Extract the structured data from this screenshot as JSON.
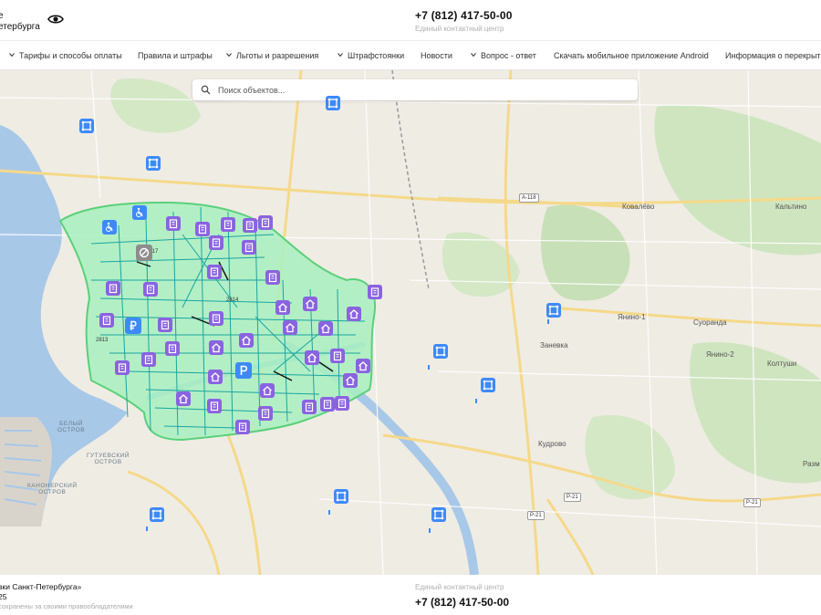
{
  "header": {
    "brand_line1": "е",
    "brand_line2": "етербурга",
    "phone": "+7 (812) 417-50-00",
    "phone_subtitle": "Единый контактный центр"
  },
  "nav": {
    "items": [
      {
        "label": "Тарифы и способы оплаты",
        "has_dropdown": true
      },
      {
        "label": "Правила и штрафы",
        "has_dropdown": false
      },
      {
        "label": "Льготы и разрешения",
        "has_dropdown": true
      },
      {
        "label": "Штрафстоянки",
        "has_dropdown": true
      },
      {
        "label": "Новости",
        "has_dropdown": false
      },
      {
        "label": "Вопрос - ответ",
        "has_dropdown": true
      },
      {
        "label": "Скачать мобильное приложение Android",
        "has_dropdown": false
      },
      {
        "label": "Информация о перекрыти",
        "has_dropdown": false
      }
    ]
  },
  "search": {
    "placeholder": "Поиск объектов..."
  },
  "map": {
    "places": {
      "kovalevo": "Ковалёво",
      "kaltino": "Кальтино",
      "yanino1": "Янино-1",
      "suoranda": "Суоранда",
      "zanevka": "Заневка",
      "yanino2": "Янино-2",
      "koltushi": "Колтуши",
      "kudrovo": "Кудрово",
      "razm": "Разм",
      "bely_ostrov": "БЕЛЫЙ\nОСТРОВ",
      "gutuevsky": "ГУТУЕВСКИЙ\nОСТРОВ",
      "kanonersky": "КАНОНЕРСКИЙ\nОСТРОВ"
    },
    "roads": {
      "a118": "А-118",
      "r21a": "Р-21",
      "r21b": "Р-21",
      "r21c": "Р-21"
    },
    "zones": {
      "z2817": "2817",
      "z2814": "2814",
      "z2813": "2813"
    },
    "colors": {
      "paid_zone_fill": "#a8f0c0",
      "paid_zone_border": "#5ad07a",
      "parking_lines": "#1aa5a0",
      "water": "#a8c8e8",
      "park": "#c8e0b8",
      "road_major": "#f5d98a",
      "pin_blue": "#3d8af7",
      "pin_purple": "#8a63e0"
    }
  },
  "footer": {
    "line1": "вки Санкт-Петербурга»",
    "line2": "25",
    "line3": "сохранены за своими правообладателями",
    "contact_subtitle": "Единый контактный центр",
    "phone": "+7 (812) 417-50-00"
  }
}
